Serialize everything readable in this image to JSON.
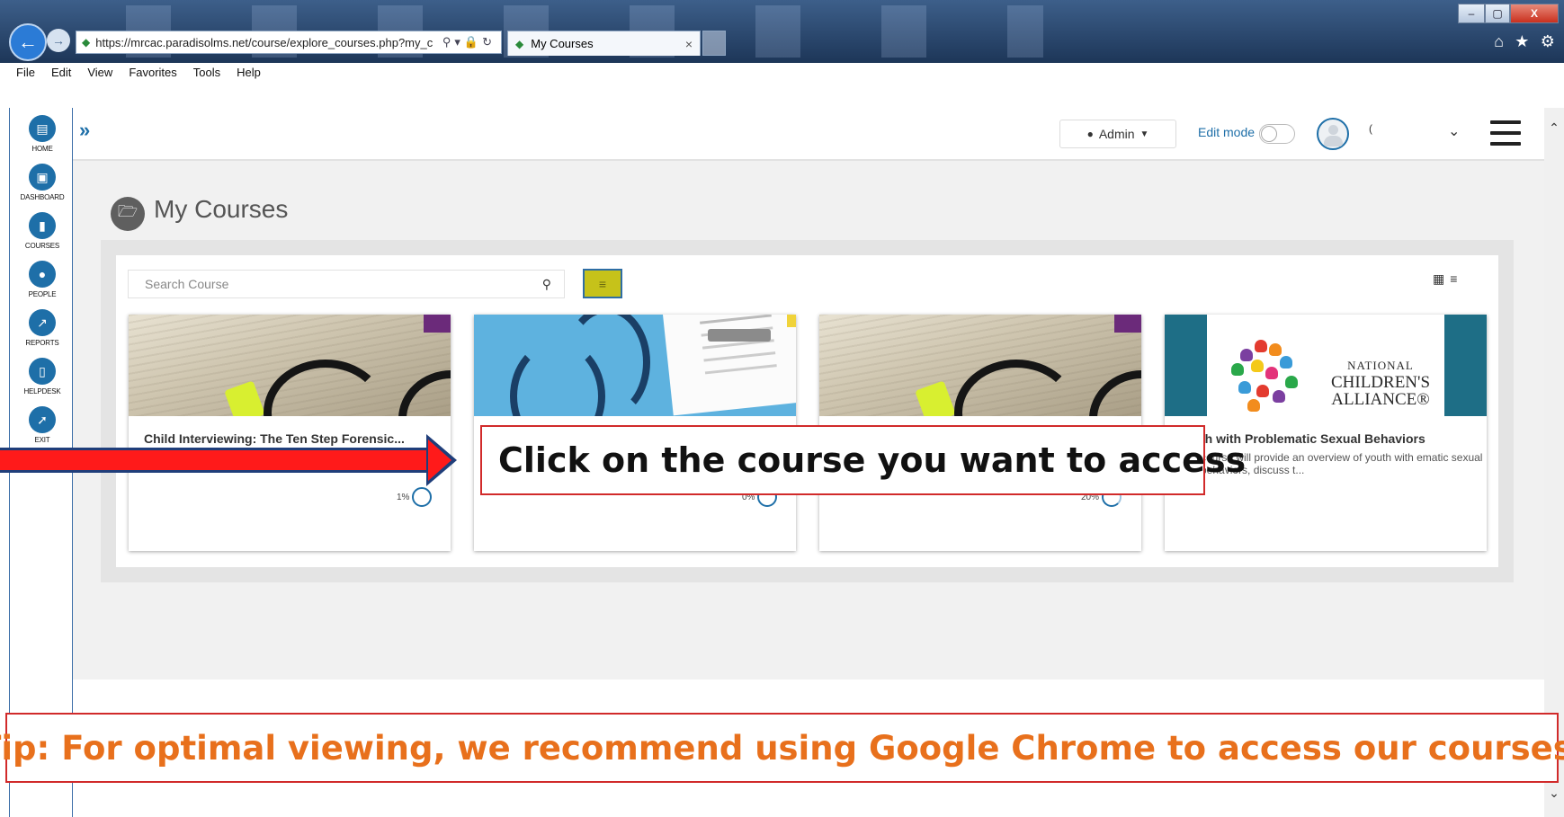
{
  "browser": {
    "url": "https://mrcac.paradisolms.net/course/explore_courses.php?my_c",
    "tab_title": "My Courses",
    "menu": [
      "File",
      "Edit",
      "View",
      "Favorites",
      "Tools",
      "Help"
    ],
    "window_buttons": [
      "–",
      "▢",
      "X"
    ]
  },
  "sidebar": {
    "items": [
      {
        "label": "HOME",
        "icon": "home-icon"
      },
      {
        "label": "DASHBOARD",
        "icon": "dashboard-icon"
      },
      {
        "label": "COURSES",
        "icon": "folder-icon"
      },
      {
        "label": "PEOPLE",
        "icon": "people-icon"
      },
      {
        "label": "REPORTS",
        "icon": "chart-icon"
      },
      {
        "label": "HELPDESK",
        "icon": "book-icon"
      },
      {
        "label": "EXIT",
        "icon": "exit-icon"
      }
    ]
  },
  "header": {
    "role_label": "Admin",
    "edit_mode_label": "Edit mode",
    "edit_mode_on": false,
    "username": "("
  },
  "page": {
    "title": "My Courses",
    "search_placeholder": "Search Course"
  },
  "courses": [
    {
      "title": "Child Interviewing: The Ten Step Forensic...",
      "description": "",
      "progress_label": "1%",
      "progress": 1,
      "image": "book-glasses"
    },
    {
      "title": "",
      "description": "",
      "progress_label": "0%",
      "progress": 0,
      "image": "scrubs-stethoscope"
    },
    {
      "title": "",
      "description": "",
      "progress_label": "20%",
      "progress": 20,
      "image": "book-glasses"
    },
    {
      "title": "th with Problematic Sexual Behaviors",
      "description": "course will provide an overview of youth with ematic sexual behaviors, discuss t...",
      "progress_label": "",
      "progress": null,
      "image": "nca-logo"
    }
  ],
  "nca_logo": {
    "line1": "NATIONAL",
    "line2": "CHILDREN'S",
    "line3": "ALLIANCE®"
  },
  "annotations": {
    "callout": "Click on the course you want to access",
    "tip": "Tip: For optimal viewing, we recommend using Google Chrome to access our courses."
  },
  "colors": {
    "accent": "#1e6fa8",
    "callout_border": "#d12a2a",
    "tip_text": "#e8701c",
    "filter_button": "#c6c21a"
  }
}
